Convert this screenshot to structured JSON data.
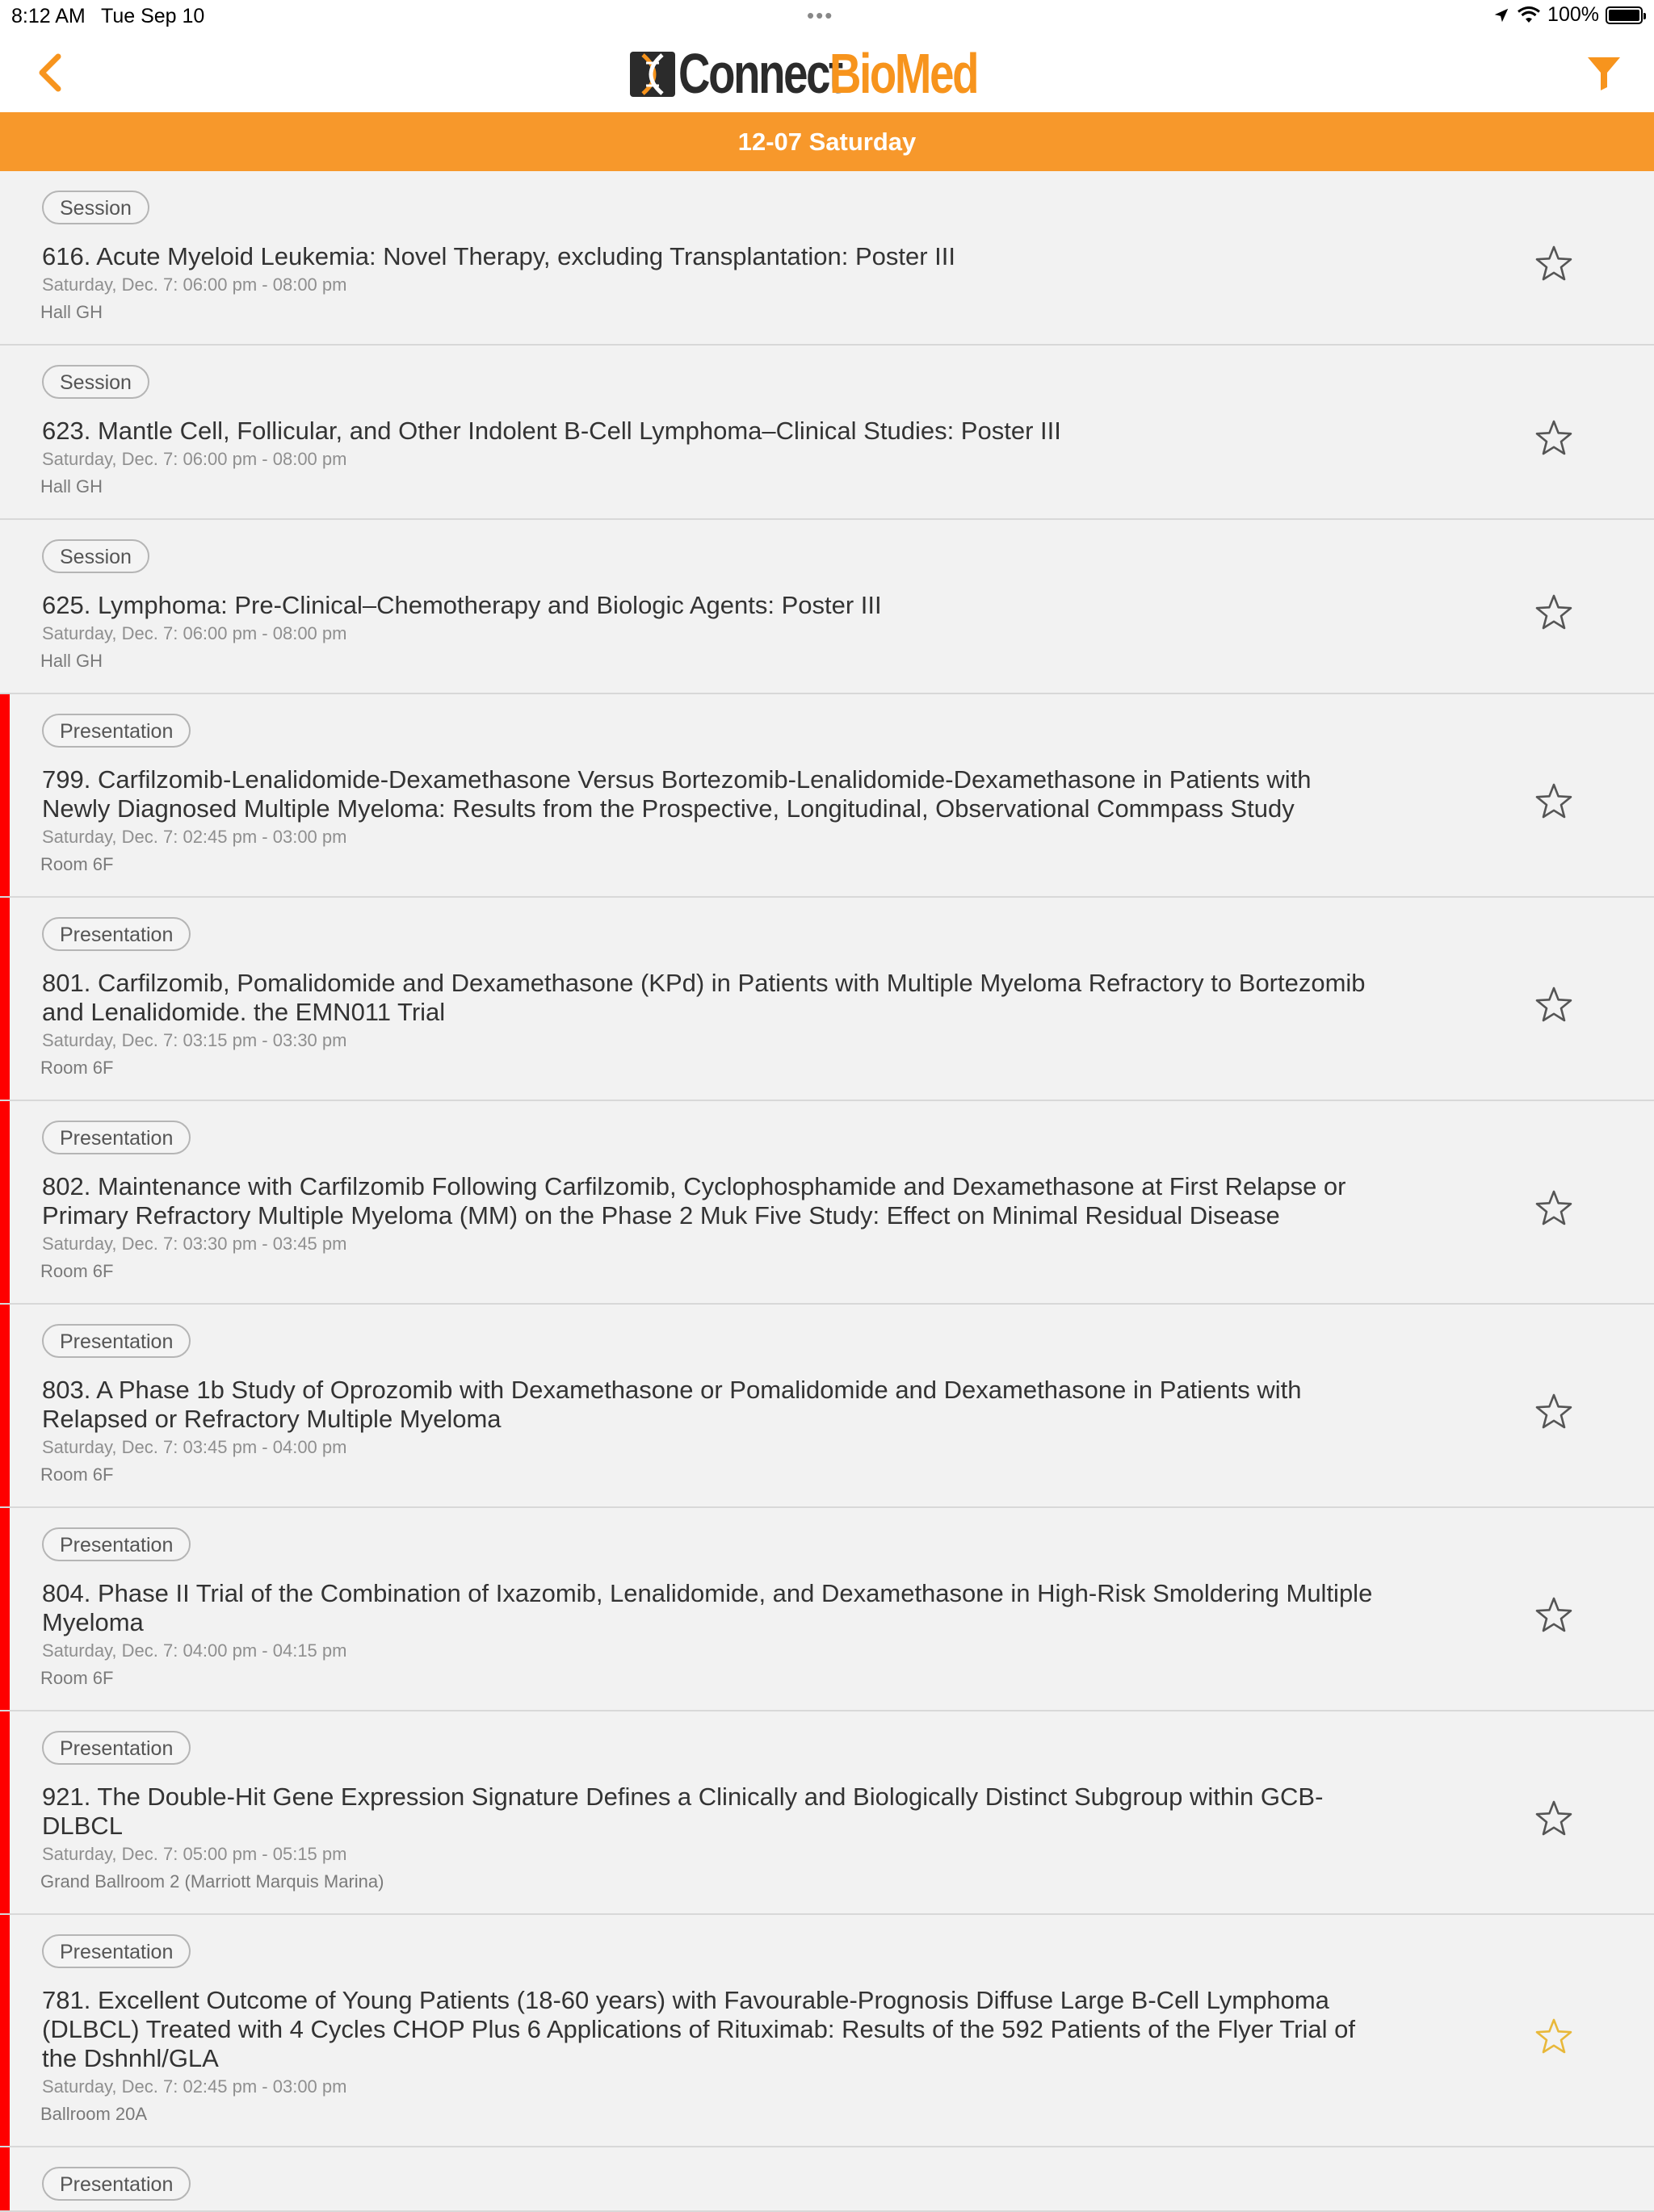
{
  "status": {
    "time": "8:12 AM",
    "date": "Tue Sep 10",
    "dots": "•••",
    "battery": "100%"
  },
  "nav": {
    "logo_dark": "Connect",
    "logo_orange": "BioMed"
  },
  "day_header": "12-07 Saturday",
  "colors": {
    "accent": "#f7982b",
    "red_marker": "#fe0000",
    "star_favorited": "#e8b83a"
  },
  "items": [
    {
      "type": "Session",
      "title_lines": [
        "616. Acute Myeloid Leukemia: Novel Therapy, excluding Transplantation: Poster III"
      ],
      "time": "Saturday, Dec. 7: 06:00 pm - 08:00 pm",
      "room": "Hall GH",
      "red": false,
      "favorited": false
    },
    {
      "type": "Session",
      "title_lines": [
        "623. Mantle Cell, Follicular, and Other Indolent B-Cell Lymphoma–Clinical Studies: Poster III"
      ],
      "time": "Saturday, Dec. 7: 06:00 pm - 08:00 pm",
      "room": "Hall GH",
      "red": false,
      "favorited": false
    },
    {
      "type": "Session",
      "title_lines": [
        "625. Lymphoma: Pre-Clinical–Chemotherapy and Biologic Agents: Poster III"
      ],
      "time": "Saturday, Dec. 7: 06:00 pm - 08:00 pm",
      "room": "Hall GH",
      "red": false,
      "favorited": false
    },
    {
      "type": "Presentation",
      "title_lines": [
        "799. Carfilzomib-Lenalidomide-Dexamethasone Versus Bortezomib-Lenalidomide-Dexamethasone in Patients with",
        "Newly Diagnosed Multiple Myeloma: Results from the Prospective, Longitudinal, Observational Commpass Study"
      ],
      "time": "Saturday, Dec. 7: 02:45 pm - 03:00 pm",
      "room": "Room 6F",
      "red": true,
      "favorited": false
    },
    {
      "type": "Presentation",
      "title_lines": [
        "801. Carfilzomib, Pomalidomide and Dexamethasone (KPd) in Patients with Multiple Myeloma Refractory to Bortezomib",
        "and Lenalidomide. the EMN011 Trial"
      ],
      "time": "Saturday, Dec. 7: 03:15 pm - 03:30 pm",
      "room": "Room 6F",
      "red": true,
      "favorited": false
    },
    {
      "type": "Presentation",
      "title_lines": [
        "802. Maintenance with Carfilzomib Following Carfilzomib, Cyclophosphamide and Dexamethasone at First Relapse or",
        "Primary Refractory Multiple Myeloma (MM) on the Phase 2 Muk Five Study: Effect on Minimal Residual Disease"
      ],
      "time": "Saturday, Dec. 7: 03:30 pm - 03:45 pm",
      "room": "Room 6F",
      "red": true,
      "favorited": false
    },
    {
      "type": "Presentation",
      "title_lines": [
        "803. A Phase 1b Study of Oprozomib with Dexamethasone or Pomalidomide and Dexamethasone in Patients with",
        "Relapsed or Refractory Multiple Myeloma"
      ],
      "time": "Saturday, Dec. 7: 03:45 pm - 04:00 pm",
      "room": "Room 6F",
      "red": true,
      "favorited": false
    },
    {
      "type": "Presentation",
      "title_lines": [
        "804. Phase II Trial of the Combination of Ixazomib, Lenalidomide, and Dexamethasone in High-Risk Smoldering Multiple",
        "Myeloma"
      ],
      "time": "Saturday, Dec. 7: 04:00 pm - 04:15 pm",
      "room": "Room 6F",
      "red": true,
      "favorited": false
    },
    {
      "type": "Presentation",
      "title_lines": [
        "921. The Double-Hit Gene Expression Signature Defines a Clinically and Biologically Distinct Subgroup within GCB-",
        "DLBCL"
      ],
      "time": "Saturday, Dec. 7: 05:00 pm - 05:15 pm",
      "room": "Grand Ballroom 2 (Marriott Marquis Marina)",
      "red": true,
      "favorited": false
    },
    {
      "type": "Presentation",
      "title_lines": [
        "781. Excellent Outcome of Young Patients (18-60 years) with Favourable-Prognosis Diffuse Large B-Cell Lymphoma",
        "(DLBCL) Treated with 4 Cycles CHOP Plus 6 Applications of Rituximab: Results of the 592 Patients of the Flyer Trial of",
        "the Dshnhl/GLA"
      ],
      "time": "Saturday, Dec. 7: 02:45 pm - 03:00 pm",
      "room": "Ballroom 20A",
      "red": true,
      "favorited": true
    },
    {
      "type": "Presentation",
      "title_lines": [],
      "time": "",
      "room": "",
      "red": true,
      "favorited": false
    }
  ]
}
